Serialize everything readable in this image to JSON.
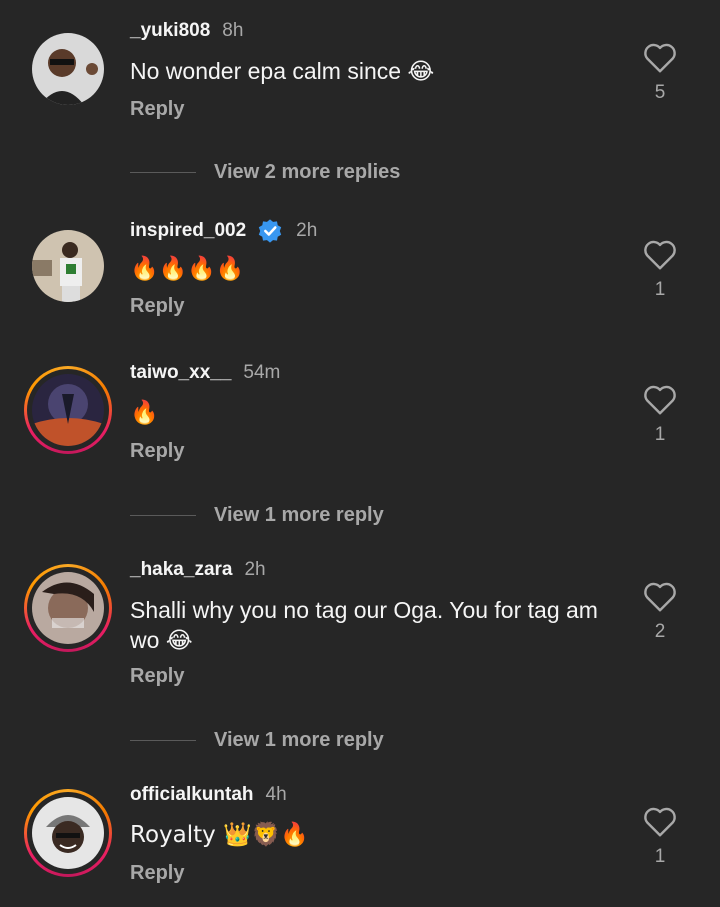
{
  "comments": [
    {
      "username": "_yuki808",
      "time": "8h",
      "text": "No wonder epa calm since 😂",
      "reply": "Reply",
      "likes": "5"
    },
    {
      "username": "inspired_002",
      "time": "2h",
      "text": "🔥🔥🔥🔥",
      "reply": "Reply",
      "likes": "1"
    },
    {
      "username": "taiwo_xx__",
      "time": "54m",
      "text": "🔥",
      "reply": "Reply",
      "likes": "1"
    },
    {
      "username": "_haka_zara",
      "time": "2h",
      "text": "Shalli why you no tag our Oga. You for tag am wo 😂",
      "reply": "Reply",
      "likes": "2"
    },
    {
      "username": "officialkuntah",
      "time": "4h",
      "text": "Royalty 👑🦁🔥",
      "reply": "Reply",
      "likes": "1"
    }
  ],
  "view_more": [
    {
      "label": "View 2 more replies"
    },
    {
      "label": "View 1 more reply"
    },
    {
      "label": "View 1 more reply"
    }
  ],
  "colors": {
    "background": "#262626",
    "verified": "#3897f0",
    "muted": "#a8a8a8"
  }
}
